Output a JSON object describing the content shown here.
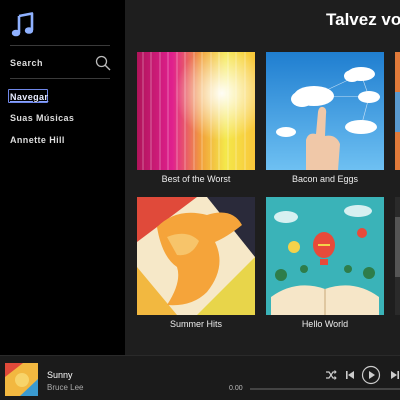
{
  "sidebar": {
    "logo_icon": "music-note-icon",
    "search_label": "Search",
    "nav": [
      {
        "label": "Navegar",
        "active": true
      },
      {
        "label": "Suas Músicas",
        "active": false
      },
      {
        "label": "Annette Hill",
        "active": false
      }
    ]
  },
  "main": {
    "title": "Talvez vo",
    "cards": [
      {
        "caption": "Best of the Worst"
      },
      {
        "caption": "Bacon and Eggs"
      },
      {
        "caption": "Summer Hits"
      },
      {
        "caption": "Hello World"
      }
    ]
  },
  "player": {
    "track_title": "Sunny",
    "artist": "Bruce Lee",
    "time": "0.00",
    "progress": 0,
    "controls": [
      "shuffle-icon",
      "previous-icon",
      "play-icon",
      "next-icon"
    ]
  },
  "colors": {
    "accent": "#6f87e8",
    "sidebar_bg": "#000000",
    "main_bg": "#1e1e1e",
    "player_bg": "#1b1b1b"
  }
}
